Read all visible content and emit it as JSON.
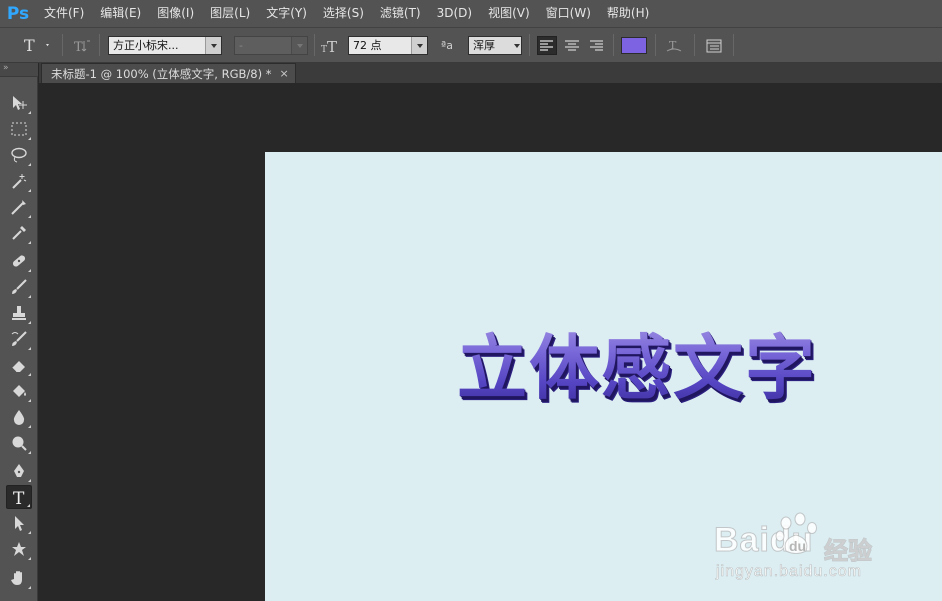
{
  "app": {
    "logo": "Ps"
  },
  "menu": [
    "文件(F)",
    "编辑(E)",
    "图像(I)",
    "图层(L)",
    "文字(Y)",
    "选择(S)",
    "滤镜(T)",
    "3D(D)",
    "视图(V)",
    "窗口(W)",
    "帮助(H)"
  ],
  "options_bar": {
    "tool_icon": "type-tool-icon",
    "font_family": "方正小标宋...",
    "font_style": "-",
    "font_size": "72 点",
    "aa_label": "ªa",
    "antialias": "浑厚",
    "text_color": "#7d63e2"
  },
  "document": {
    "tab_title": "未标题-1 @ 100% (立体感文字, RGB/8) *",
    "close": "×",
    "canvas_color": "#ddeef3",
    "text": "立体感文字",
    "text_color": "#6656cf"
  },
  "tools": [
    "move-tool",
    "marquee-tool",
    "lasso-tool",
    "magic-wand-tool",
    "crop-tool",
    "eyedropper-tool",
    "healing-brush-tool",
    "brush-tool",
    "clone-stamp-tool",
    "history-brush-tool",
    "eraser-tool",
    "paint-bucket-tool",
    "blur-tool",
    "dodge-tool",
    "pen-tool",
    "type-tool",
    "path-selection-tool",
    "shape-tool",
    "hand-tool"
  ],
  "watermark": {
    "logo": "Baidu",
    "brand": "经验",
    "url": "jingyan.baidu.com"
  }
}
